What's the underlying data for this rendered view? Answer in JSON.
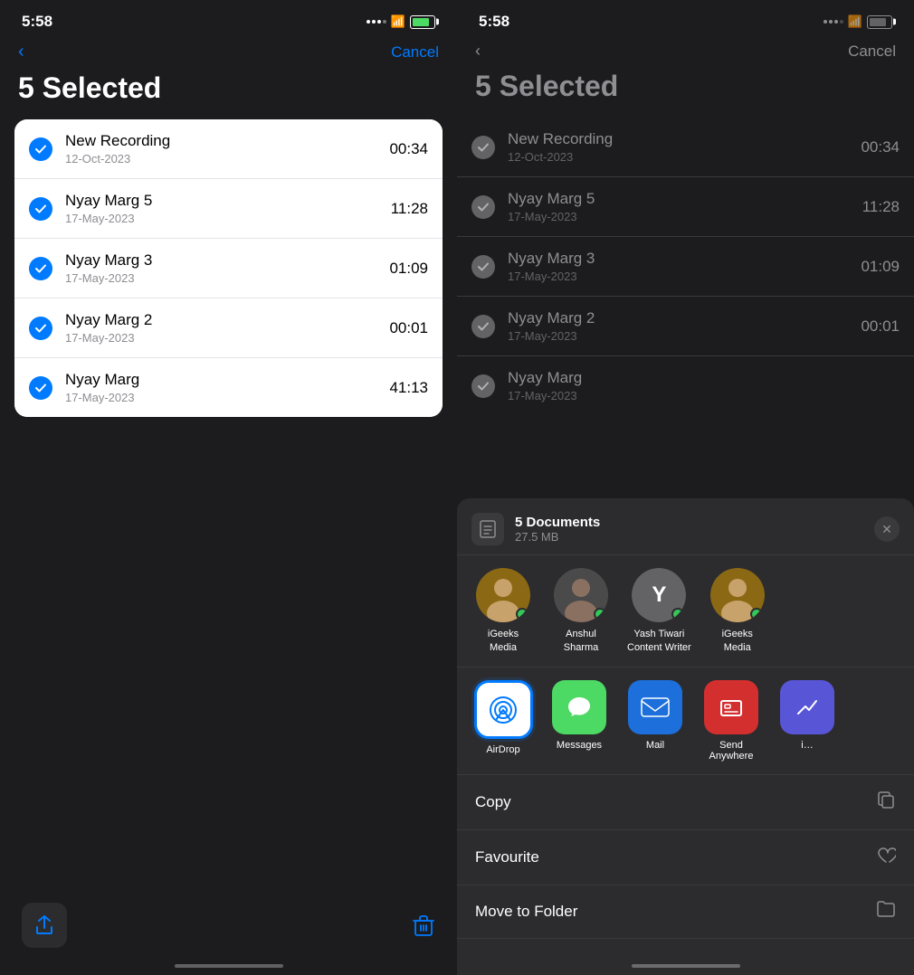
{
  "left": {
    "status": {
      "time": "5:58",
      "battery_level": "70"
    },
    "nav": {
      "back_label": "‹",
      "cancel_label": "Cancel"
    },
    "title": "5 Selected",
    "recordings": [
      {
        "name": "New Recording",
        "date": "12-Oct-2023",
        "duration": "00:34",
        "checked": true
      },
      {
        "name": "Nyay Marg 5",
        "date": "17-May-2023",
        "duration": "11:28",
        "checked": true
      },
      {
        "name": "Nyay Marg 3",
        "date": "17-May-2023",
        "duration": "01:09",
        "checked": true
      },
      {
        "name": "Nyay Marg 2",
        "date": "17-May-2023",
        "duration": "00:01",
        "checked": true
      },
      {
        "name": "Nyay Marg",
        "date": "17-May-2023",
        "duration": "41:13",
        "checked": true
      }
    ],
    "toolbar": {
      "share_label": "↑",
      "trash_label": "🗑"
    }
  },
  "right": {
    "status": {
      "time": "5:58"
    },
    "nav": {
      "back_label": "‹",
      "cancel_label": "Cancel"
    },
    "title": "5 Selected",
    "recordings": [
      {
        "name": "New Recording",
        "date": "12-Oct-2023",
        "duration": "00:34",
        "checked": true
      },
      {
        "name": "Nyay Marg 5",
        "date": "17-May-2023",
        "duration": "11:28",
        "checked": true
      },
      {
        "name": "Nyay Marg 3",
        "date": "17-May-2023",
        "duration": "01:09",
        "checked": true
      },
      {
        "name": "Nyay Marg 2",
        "date": "17-May-2023",
        "duration": "00:01",
        "checked": true
      },
      {
        "name": "Nyay Marg",
        "date": "17-May-2023",
        "duration": "",
        "checked": true
      }
    ],
    "share_sheet": {
      "doc_count": "5 Documents",
      "doc_size": "27.5 MB",
      "people": [
        {
          "name": "iGeeks\nMedia",
          "color": "#8b6914",
          "initials": ""
        },
        {
          "name": "Anshul\nSharma",
          "color": "#4a4a4a",
          "initials": ""
        },
        {
          "name": "Yash Tiwari\nContent Writer",
          "color": "#636366",
          "initials": "Y"
        },
        {
          "name": "iGeeks\nMedia",
          "color": "#8b6914",
          "initials": ""
        }
      ],
      "apps": [
        {
          "name": "AirDrop",
          "icon_type": "airdrop",
          "selected": true
        },
        {
          "name": "Messages",
          "icon_type": "messages"
        },
        {
          "name": "Mail",
          "icon_type": "mail"
        },
        {
          "name": "Send\nAnywhere",
          "icon_type": "sendanywhere"
        },
        {
          "name": "i…",
          "icon_type": "more"
        }
      ],
      "actions": [
        {
          "label": "Copy",
          "icon": "📋"
        },
        {
          "label": "Favourite",
          "icon": "♡"
        },
        {
          "label": "Move to Folder",
          "icon": "🗂"
        }
      ]
    }
  }
}
